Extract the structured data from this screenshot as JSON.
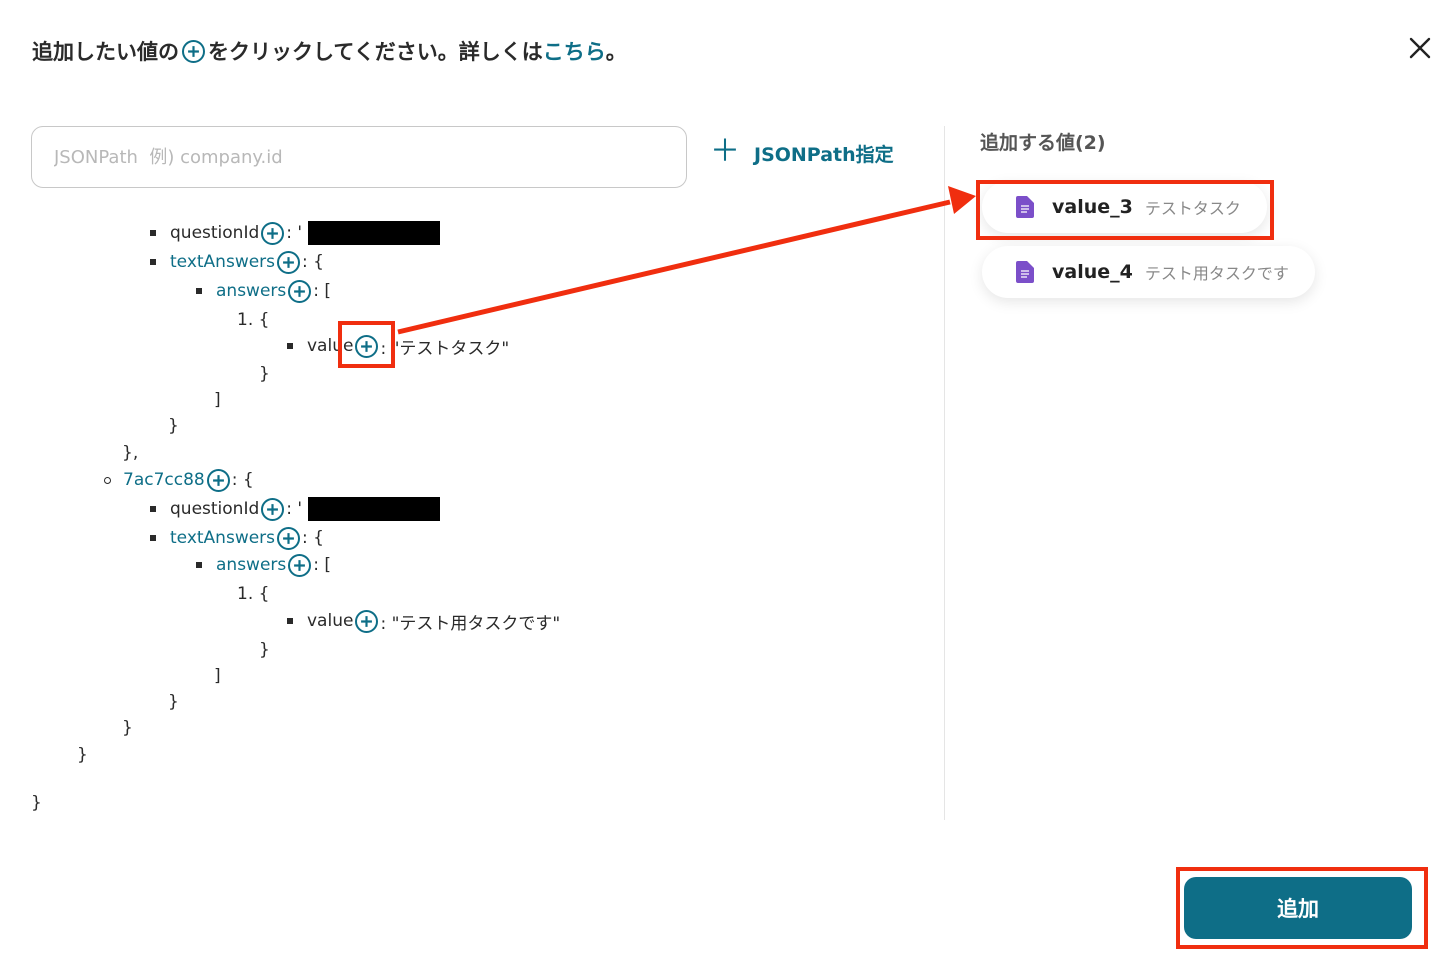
{
  "header": {
    "prefix": "追加したい値の",
    "suffix": "をクリックしてください。詳しくは",
    "link": "こちら",
    "end": "。"
  },
  "search": {
    "placeholder": "JSONPath  例) company.id",
    "button_label": "JSONPath指定"
  },
  "tree": {
    "q1_key": "questionId",
    "q1_text_key": "textAnswers",
    "q1_answers_key": "answers",
    "q1_item_index": "1. {",
    "q1_value_key": "value",
    "q1_value": ": \"テストタスク\"",
    "node2_key": "7ac7cc88",
    "q2_key": "questionId",
    "q2_text_key": "textAnswers",
    "q2_answers_key": "answers",
    "q2_item_index": "1. {",
    "q2_value_key": "value",
    "q2_value": ": \"テスト用タスクです\"",
    "colon": ":",
    "colon_quote": ": '",
    "open_brace": ": {",
    "open_bracket": ": [",
    "close_brace": "}",
    "close_bracket": "]",
    "close_brace_comma": "},"
  },
  "selected": {
    "title": "追加する値(2)",
    "items": [
      {
        "key": "value_3",
        "value": "テストタスク"
      },
      {
        "key": "value_4",
        "value": "テスト用タスクです"
      }
    ]
  },
  "footer": {
    "add_label": "追加"
  },
  "colors": {
    "accent": "#0e6e87",
    "annotation": "#f02e0f",
    "doc_icon": "#7b4fc9"
  }
}
